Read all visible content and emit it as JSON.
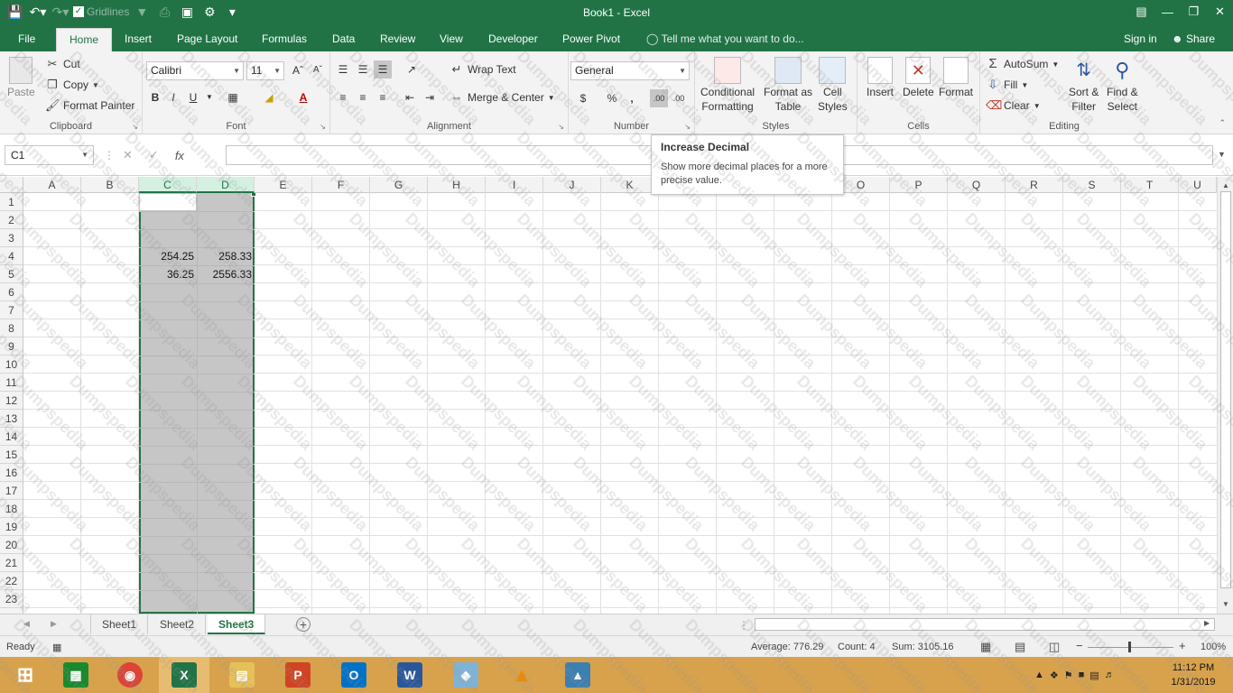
{
  "window": {
    "title": "Book1 - Excel"
  },
  "qat": {
    "save_icon": "save-icon",
    "undo_icon": "undo-icon",
    "redo_icon": "redo-icon",
    "gridlines_label": "Gridlines"
  },
  "tabs": [
    {
      "label": "File"
    },
    {
      "label": "Home"
    },
    {
      "label": "Insert"
    },
    {
      "label": "Page Layout"
    },
    {
      "label": "Formulas"
    },
    {
      "label": "Data"
    },
    {
      "label": "Review"
    },
    {
      "label": "View"
    },
    {
      "label": "Developer"
    },
    {
      "label": "Power Pivot"
    }
  ],
  "tell_me": "Tell me what you want to do...",
  "account": {
    "signin": "Sign in",
    "share": "Share"
  },
  "ribbon": {
    "clipboard": {
      "paste": "Paste",
      "cut": "Cut",
      "copy": "Copy",
      "format_painter": "Format Painter",
      "label": "Clipboard"
    },
    "font": {
      "name": "Calibri",
      "size": "11",
      "label": "Font",
      "bold": "B",
      "italic": "I",
      "underline": "U"
    },
    "alignment": {
      "wrap_text": "Wrap Text",
      "merge_center": "Merge & Center",
      "label": "Alignment"
    },
    "number": {
      "format": "General",
      "currency": "$",
      "percent": "%",
      "comma": ",",
      "inc_dec": ".00",
      "label": "Number"
    },
    "styles": {
      "cond_formatting_1": "Conditional",
      "cond_formatting_2": "Formatting",
      "format_table_1": "Format as",
      "format_table_2": "Table",
      "cell_styles_1": "Cell",
      "cell_styles_2": "Styles",
      "label": "Styles"
    },
    "cells": {
      "insert": "Insert",
      "delete": "Delete",
      "format": "Format",
      "label": "Cells"
    },
    "editing": {
      "autosum": "AutoSum",
      "fill": "Fill",
      "clear": "Clear",
      "sort_1": "Sort &",
      "sort_2": "Filter",
      "find_1": "Find &",
      "find_2": "Select",
      "label": "Editing"
    }
  },
  "formula_bar": {
    "name_box": "C1",
    "fx": "fx",
    "value": ""
  },
  "tooltip": {
    "title": "Increase Decimal",
    "body": "Show more decimal places for a more precise value."
  },
  "columns": [
    "A",
    "B",
    "C",
    "D",
    "E",
    "F",
    "G",
    "H",
    "I",
    "J",
    "K",
    "L",
    "M",
    "N",
    "O",
    "P",
    "Q",
    "R",
    "S",
    "T",
    "U"
  ],
  "rows": [
    "1",
    "2",
    "3",
    "4",
    "5",
    "6",
    "7",
    "8",
    "9",
    "10",
    "11",
    "12",
    "13",
    "14",
    "15",
    "16",
    "17",
    "18",
    "19",
    "20",
    "21",
    "22",
    "23"
  ],
  "cells": {
    "C4": "254.25",
    "D4": "258.33",
    "C5": "36.25",
    "D5": "2556.33"
  },
  "sheets": [
    {
      "label": "Sheet1"
    },
    {
      "label": "Sheet2"
    },
    {
      "label": "Sheet3"
    }
  ],
  "status": {
    "ready": "Ready",
    "average": "Average: 776.29",
    "count": "Count: 4",
    "sum": "Sum: 3105.16",
    "zoom": "100%"
  },
  "clock": {
    "time": "11:12 PM",
    "date": "1/31/2019"
  },
  "watermark": "Dumpspedia",
  "colors": {
    "accent": "#217346",
    "selection": "#c6c6c6",
    "taskbar": "#d8a24c"
  }
}
